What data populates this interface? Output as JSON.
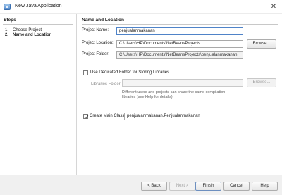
{
  "window": {
    "title": "New Java Application"
  },
  "steps": {
    "heading": "Steps",
    "items": [
      {
        "num": "1.",
        "label": "Choose Project"
      },
      {
        "num": "2.",
        "label": "Name and Location"
      }
    ]
  },
  "main": {
    "heading": "Name and Location",
    "project_name": {
      "label": "Project Name:",
      "value": "penjualanmakanan"
    },
    "project_location": {
      "label": "Project Location:",
      "value": "C:\\Users\\HP\\Documents\\NetBeansProjects",
      "browse_label": "Browse..."
    },
    "project_folder": {
      "label": "Project Folder:",
      "value": "C:\\Users\\HP\\Documents\\NetBeansProjects\\penjualanmakanan"
    },
    "dedicated_folder": {
      "label": "Use Dedicated Folder for Storing Libraries",
      "checked": false,
      "libraries_label": "Libraries Folder:",
      "libraries_value": "",
      "browse_label": "Browse...",
      "note_line1": "Different users and projects can share the same compilation",
      "note_line2": "libraries (see Help for details)."
    },
    "main_class": {
      "label": "Create Main Class",
      "checked": true,
      "value": "penjualanmakanan.Penjualanmakanan"
    }
  },
  "footer": {
    "back_label": "< Back",
    "next_label": "Next >",
    "finish_label": "Finish",
    "cancel_label": "Cancel",
    "help_label": "Help"
  }
}
